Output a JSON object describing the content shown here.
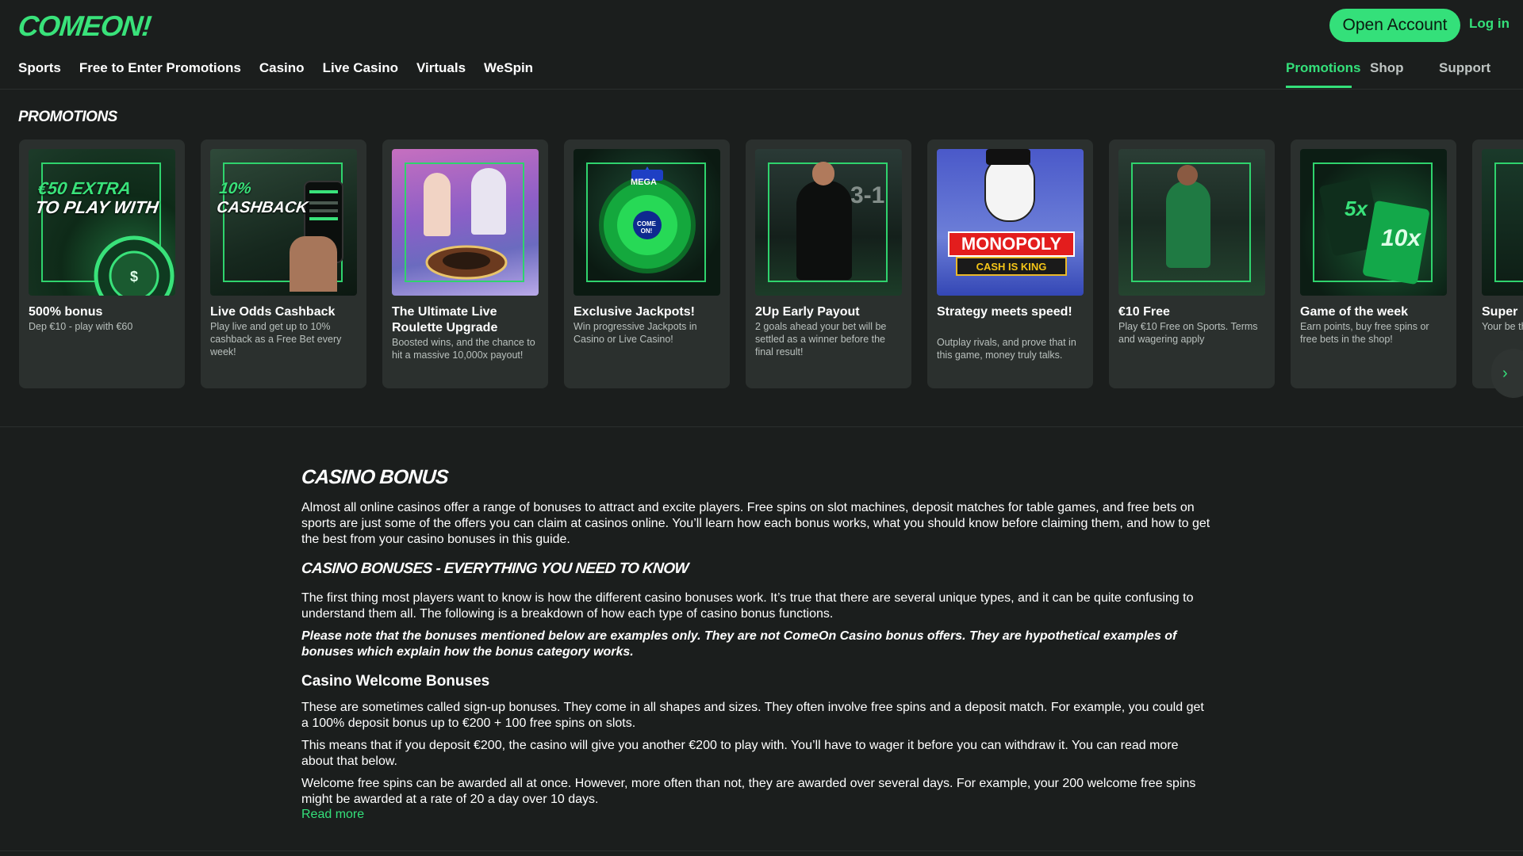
{
  "header": {
    "logo": "COMEON!",
    "open_account": "Open Account",
    "login": "Log in",
    "nav_left": [
      "Sports",
      "Free to Enter Promotions",
      "Casino",
      "Live Casino",
      "Virtuals",
      "WeSpin"
    ],
    "nav_right": [
      "Promotions",
      "Shop",
      "Support"
    ],
    "active_nav": "Promotions"
  },
  "promotions": {
    "heading": "PROMOTIONS",
    "next_icon": "chevron-right-icon",
    "cards": [
      {
        "title": "500% bonus",
        "desc": "Dep €10 - play with €60",
        "image_text": [
          "€50 EXTRA",
          "TO PLAY WITH"
        ]
      },
      {
        "title": "Live Odds Cashback",
        "desc": "Play live and get up to 10% cashback as a Free Bet every week!",
        "image_text": [
          "10%",
          "CASHBACK"
        ]
      },
      {
        "title": "The Ultimate Live Roulette Upgrade",
        "desc": "Boosted wins, and the chance to hit a massive 10,000x payout!"
      },
      {
        "title": "Exclusive Jackpots!",
        "desc": "Win progressive Jackpots in Casino or Live Casino!",
        "image_text": [
          "MEGA",
          "COME ON!"
        ]
      },
      {
        "title": "2Up Early Payout",
        "desc": "2 goals ahead your bet will be settled as a winner before the final result!",
        "image_text": [
          "3-1"
        ]
      },
      {
        "title": "Strategy meets speed!",
        "desc": "Outplay rivals, and prove that in this game, money truly talks.",
        "image_text": [
          "MONOPOLY",
          "CASH IS KING"
        ]
      },
      {
        "title": "€10 Free",
        "desc": "Play €10 Free on Sports. Terms and wagering apply"
      },
      {
        "title": "Game of the week",
        "desc": "Earn points, buy free spins or free bets in the shop!",
        "image_text": [
          "5x",
          "10x"
        ]
      },
      {
        "title": "Super",
        "desc": "Your be the nex"
      }
    ]
  },
  "article": {
    "title": "CASINO BONUS",
    "intro": "Almost all online casinos offer a range of bonuses to attract and excite players. Free spins on slot machines, deposit matches for table games, and free bets on sports are just some of the offers you can claim at casinos online. You’ll learn how each bonus works, what you should know before claiming them, and how to get the best from your casino bonuses in this guide.",
    "subtitle": "CASINO BONUSES - EVERYTHING YOU NEED TO KNOW",
    "p2": "The first thing most players want to know is how the different casino bonuses work. It’s true that there are several unique types, and it can be quite confusing to understand them all. The following is a breakdown of how each type of casino bonus functions.",
    "note": "Please note that the bonuses mentioned below are examples only. They are not ComeOn Casino bonus offers. They are hypothetical examples of bonuses which explain how the bonus category works.",
    "h3": "Casino Welcome Bonuses",
    "p4": "These are sometimes called sign-up bonuses. They come in all shapes and sizes. They often involve free spins and a deposit match. For example, you could get a 100% deposit bonus up to €200 + 100 free spins on slots.",
    "p5": "This means that if you deposit €200, the casino will give you another €200 to play with. You’ll have to wager it before you can withdraw it. You can read more about that below.",
    "p6": "Welcome free spins can be awarded all at once. However, more often than not, they are awarded over several days. For example, your 200 welcome free spins might be awarded at a rate of 20 a day over 10 days.",
    "read_more": "Read more"
  },
  "colors": {
    "accent": "#34e07a",
    "background": "#1b1e1d",
    "card": "#2b302e"
  }
}
